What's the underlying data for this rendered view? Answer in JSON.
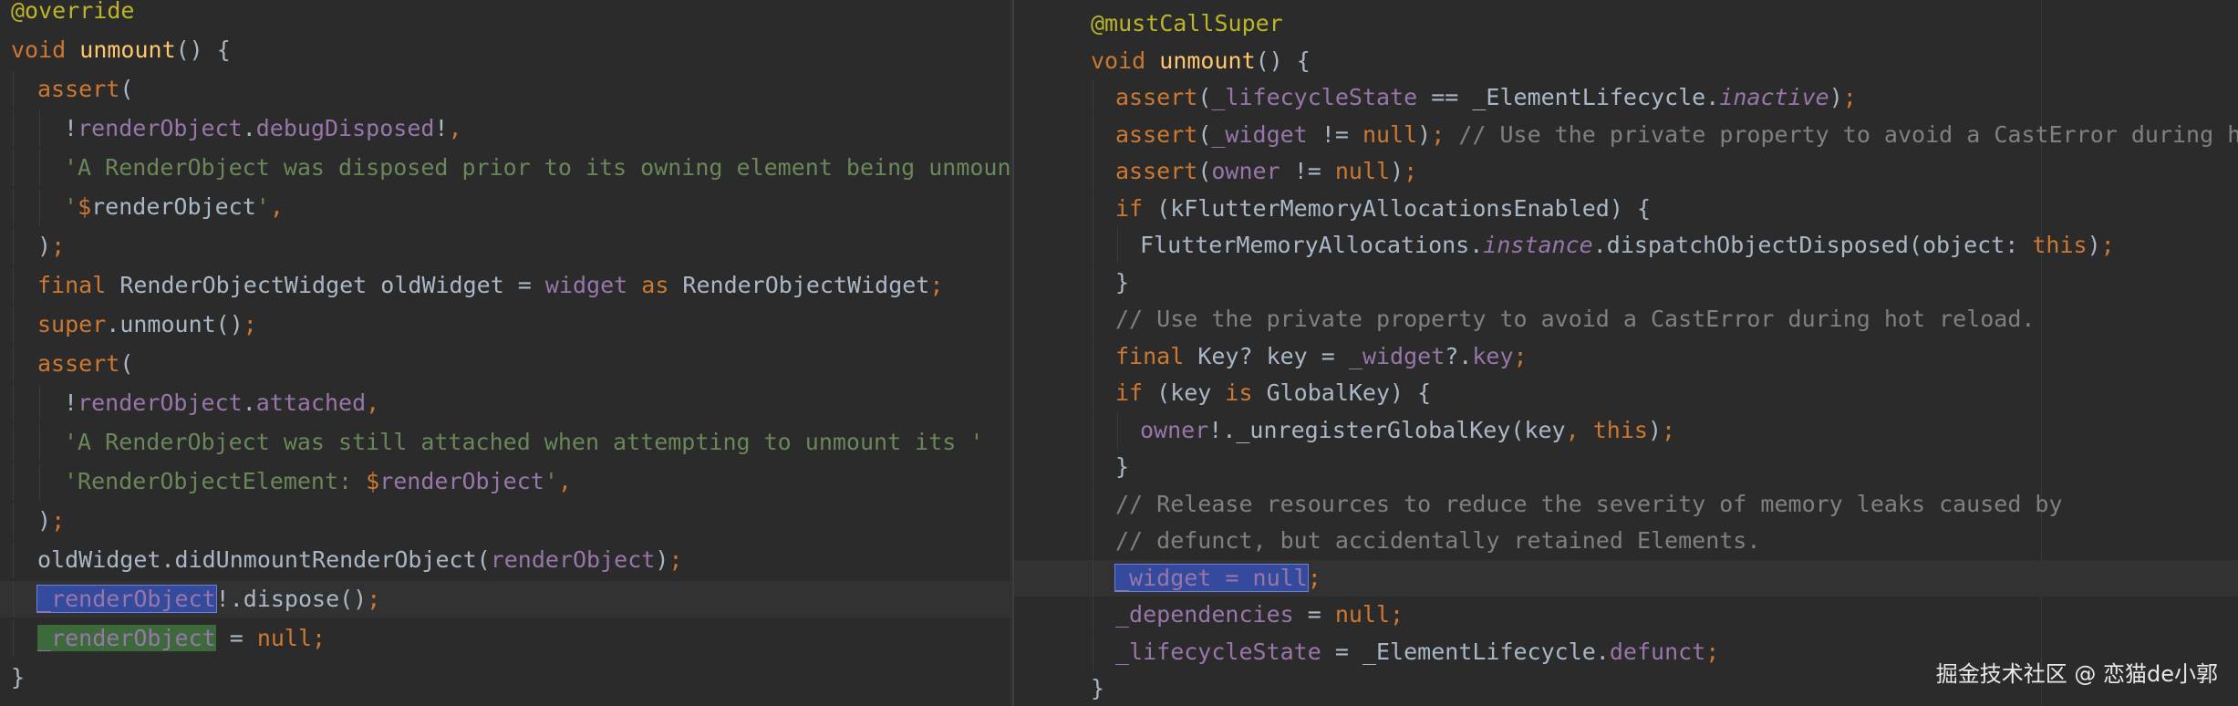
{
  "colors": {
    "background": "#2b2b2b",
    "plain": "#a9b7c6",
    "keyword": "#cc7832",
    "function": "#ffc66d",
    "field": "#9876aa",
    "string": "#6a8759",
    "comment": "#808080",
    "annotation": "#bbb529",
    "selection_blue": "#344a9c",
    "selection_green": "#3d6a3a"
  },
  "left_editor": {
    "lines": [
      {
        "indent": 0,
        "tokens": [
          {
            "t": "@override",
            "c": "annotation"
          }
        ]
      },
      {
        "indent": 0,
        "tokens": [
          {
            "t": "void ",
            "c": "keyword"
          },
          {
            "t": "unmount",
            "c": "function"
          },
          {
            "t": "() {",
            "c": "plain"
          }
        ]
      },
      {
        "indent": 1,
        "tokens": [
          {
            "t": "assert",
            "c": "keyword"
          },
          {
            "t": "(",
            "c": "plain"
          }
        ]
      },
      {
        "indent": 2,
        "tokens": [
          {
            "t": "!",
            "c": "plain"
          },
          {
            "t": "renderObject",
            "c": "field"
          },
          {
            "t": ".",
            "c": "plain"
          },
          {
            "t": "debugDisposed",
            "c": "field"
          },
          {
            "t": "!",
            "c": "plain"
          },
          {
            "t": ",",
            "c": "keyword"
          }
        ]
      },
      {
        "indent": 2,
        "tokens": [
          {
            "t": "'A RenderObject was disposed prior to its owning element being unmounted: '",
            "c": "string"
          }
        ]
      },
      {
        "indent": 2,
        "tokens": [
          {
            "t": "'",
            "c": "string"
          },
          {
            "t": "$",
            "c": "keyword"
          },
          {
            "t": "renderObject",
            "c": "plain"
          },
          {
            "t": "'",
            "c": "string"
          },
          {
            "t": ",",
            "c": "keyword"
          }
        ]
      },
      {
        "indent": 1,
        "tokens": [
          {
            "t": ")",
            "c": "plain"
          },
          {
            "t": ";",
            "c": "keyword"
          }
        ]
      },
      {
        "indent": 1,
        "tokens": [
          {
            "t": "final ",
            "c": "keyword"
          },
          {
            "t": "RenderObjectWidget oldWidget = ",
            "c": "plain"
          },
          {
            "t": "widget ",
            "c": "field"
          },
          {
            "t": "as ",
            "c": "keyword"
          },
          {
            "t": "RenderObjectWidget",
            "c": "plain"
          },
          {
            "t": ";",
            "c": "keyword"
          }
        ]
      },
      {
        "indent": 1,
        "tokens": [
          {
            "t": "super",
            "c": "keyword"
          },
          {
            "t": ".unmount()",
            "c": "plain"
          },
          {
            "t": ";",
            "c": "keyword"
          }
        ]
      },
      {
        "indent": 1,
        "tokens": [
          {
            "t": "assert",
            "c": "keyword"
          },
          {
            "t": "(",
            "c": "plain"
          }
        ]
      },
      {
        "indent": 2,
        "tokens": [
          {
            "t": "!",
            "c": "plain"
          },
          {
            "t": "renderObject",
            "c": "field"
          },
          {
            "t": ".",
            "c": "plain"
          },
          {
            "t": "attached",
            "c": "field"
          },
          {
            "t": ",",
            "c": "keyword"
          }
        ]
      },
      {
        "indent": 2,
        "tokens": [
          {
            "t": "'A RenderObject was still attached when attempting to unmount its '",
            "c": "string"
          }
        ]
      },
      {
        "indent": 2,
        "tokens": [
          {
            "t": "'RenderObjectElement: ",
            "c": "string"
          },
          {
            "t": "$",
            "c": "keyword"
          },
          {
            "t": "renderObject",
            "c": "field"
          },
          {
            "t": "'",
            "c": "string"
          },
          {
            "t": ",",
            "c": "keyword"
          }
        ]
      },
      {
        "indent": 1,
        "tokens": [
          {
            "t": ")",
            "c": "plain"
          },
          {
            "t": ";",
            "c": "keyword"
          }
        ]
      },
      {
        "indent": 1,
        "tokens": [
          {
            "t": "oldWidget.didUnmountRenderObject(",
            "c": "plain"
          },
          {
            "t": "renderObject",
            "c": "field"
          },
          {
            "t": ")",
            "c": "plain"
          },
          {
            "t": ";",
            "c": "keyword"
          }
        ]
      },
      {
        "indent": 1,
        "current": true,
        "tokens": [
          {
            "t": "_renderObject",
            "c": "field",
            "hl": "blue"
          },
          {
            "t": "!.dispose()",
            "c": "plain"
          },
          {
            "t": ";",
            "c": "keyword"
          }
        ]
      },
      {
        "indent": 1,
        "tokens": [
          {
            "t": "_renderObject",
            "c": "field",
            "hl": "green"
          },
          {
            "t": " = ",
            "c": "plain"
          },
          {
            "t": "null",
            "c": "keyword"
          },
          {
            "t": ";",
            "c": "keyword"
          }
        ]
      },
      {
        "indent": 0,
        "tokens": [
          {
            "t": "}",
            "c": "plain"
          }
        ]
      }
    ]
  },
  "right_editor": {
    "lines": [
      {
        "indent": 0,
        "tokens": [
          {
            "t": "@mustCallSuper",
            "c": "annotation"
          }
        ]
      },
      {
        "indent": 0,
        "tokens": [
          {
            "t": "void ",
            "c": "keyword"
          },
          {
            "t": "unmount",
            "c": "function"
          },
          {
            "t": "() {",
            "c": "plain"
          }
        ]
      },
      {
        "indent": 1,
        "tokens": [
          {
            "t": "assert",
            "c": "keyword"
          },
          {
            "t": "(",
            "c": "plain"
          },
          {
            "t": "_lifecycleState",
            "c": "field"
          },
          {
            "t": " == _ElementLifecycle.",
            "c": "plain"
          },
          {
            "t": "inactive",
            "c": "field",
            "italic": true
          },
          {
            "t": ")",
            "c": "plain"
          },
          {
            "t": ";",
            "c": "keyword"
          }
        ]
      },
      {
        "indent": 1,
        "tokens": [
          {
            "t": "assert",
            "c": "keyword"
          },
          {
            "t": "(",
            "c": "plain"
          },
          {
            "t": "_widget",
            "c": "field"
          },
          {
            "t": " != ",
            "c": "plain"
          },
          {
            "t": "null",
            "c": "keyword"
          },
          {
            "t": ")",
            "c": "plain"
          },
          {
            "t": "; ",
            "c": "keyword"
          },
          {
            "t": "// Use the private property to avoid a CastError during hot reload",
            "c": "comment"
          }
        ]
      },
      {
        "indent": 1,
        "tokens": [
          {
            "t": "assert",
            "c": "keyword"
          },
          {
            "t": "(",
            "c": "plain"
          },
          {
            "t": "owner",
            "c": "field"
          },
          {
            "t": " != ",
            "c": "plain"
          },
          {
            "t": "null",
            "c": "keyword"
          },
          {
            "t": ")",
            "c": "plain"
          },
          {
            "t": ";",
            "c": "keyword"
          }
        ]
      },
      {
        "indent": 1,
        "tokens": [
          {
            "t": "if ",
            "c": "keyword"
          },
          {
            "t": "(kFlutterMemoryAllocationsEnabled) {",
            "c": "plain"
          }
        ]
      },
      {
        "indent": 2,
        "tokens": [
          {
            "t": "FlutterMemoryAllocations.",
            "c": "plain"
          },
          {
            "t": "instance",
            "c": "field",
            "italic": true
          },
          {
            "t": ".dispatchObjectDisposed(object: ",
            "c": "plain"
          },
          {
            "t": "this",
            "c": "keyword"
          },
          {
            "t": ")",
            "c": "plain"
          },
          {
            "t": ";",
            "c": "keyword"
          }
        ]
      },
      {
        "indent": 1,
        "tokens": [
          {
            "t": "}",
            "c": "plain"
          }
        ]
      },
      {
        "indent": 1,
        "tokens": [
          {
            "t": "// Use the private property to avoid a CastError during hot reload.",
            "c": "comment"
          }
        ]
      },
      {
        "indent": 1,
        "tokens": [
          {
            "t": "final ",
            "c": "keyword"
          },
          {
            "t": "Key? key = ",
            "c": "plain"
          },
          {
            "t": "_widget",
            "c": "field"
          },
          {
            "t": "?.",
            "c": "plain"
          },
          {
            "t": "key",
            "c": "field"
          },
          {
            "t": ";",
            "c": "keyword"
          }
        ]
      },
      {
        "indent": 1,
        "tokens": [
          {
            "t": "if ",
            "c": "keyword"
          },
          {
            "t": "(key ",
            "c": "plain"
          },
          {
            "t": "is ",
            "c": "keyword"
          },
          {
            "t": "GlobalKey) {",
            "c": "plain"
          }
        ]
      },
      {
        "indent": 2,
        "tokens": [
          {
            "t": "owner",
            "c": "field"
          },
          {
            "t": "!._unregisterGlobalKey(key",
            "c": "plain"
          },
          {
            "t": ", ",
            "c": "keyword"
          },
          {
            "t": "this",
            "c": "keyword"
          },
          {
            "t": ")",
            "c": "plain"
          },
          {
            "t": ";",
            "c": "keyword"
          }
        ]
      },
      {
        "indent": 1,
        "tokens": [
          {
            "t": "}",
            "c": "plain"
          }
        ]
      },
      {
        "indent": 1,
        "tokens": [
          {
            "t": "// Release resources to reduce the severity of memory leaks caused by",
            "c": "comment"
          }
        ]
      },
      {
        "indent": 1,
        "tokens": [
          {
            "t": "// defunct, but accidentally retained Elements.",
            "c": "comment"
          }
        ]
      },
      {
        "indent": 1,
        "current": true,
        "tokens": [
          {
            "t": "_widget = null",
            "c": "field",
            "hl": "blue"
          },
          {
            "t": ";",
            "c": "keyword"
          }
        ]
      },
      {
        "indent": 1,
        "tokens": [
          {
            "t": "_dependencies",
            "c": "field"
          },
          {
            "t": " = ",
            "c": "plain"
          },
          {
            "t": "null",
            "c": "keyword"
          },
          {
            "t": ";",
            "c": "keyword"
          }
        ]
      },
      {
        "indent": 1,
        "tokens": [
          {
            "t": "_lifecycleState",
            "c": "field"
          },
          {
            "t": " = _ElementLifecycle.",
            "c": "plain"
          },
          {
            "t": "defunct",
            "c": "field"
          },
          {
            "t": ";",
            "c": "keyword"
          }
        ]
      },
      {
        "indent": 0,
        "tokens": [
          {
            "t": "}",
            "c": "plain"
          }
        ]
      }
    ]
  },
  "watermark": "掘金技术社区 @ 恋猫de小郭"
}
